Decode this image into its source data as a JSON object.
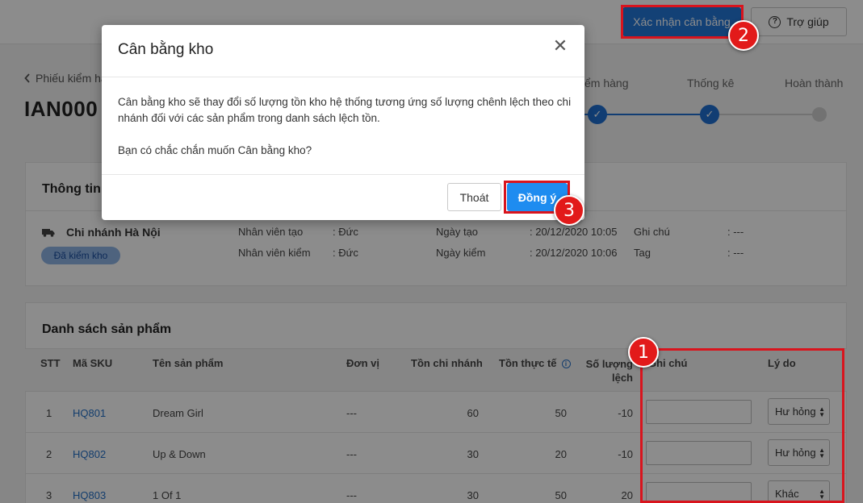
{
  "header": {
    "confirm_label": "Xác nhận cân bằng",
    "help_label": "Trợ giúp",
    "help_icon": "question-circle-icon"
  },
  "breadcrumb": {
    "label": "Phiếu kiểm hàng"
  },
  "page_title": "IAN000",
  "steps": [
    {
      "label": "Kiểm hàng",
      "visible_label": "ểm hàng",
      "state": "done"
    },
    {
      "label": "Thống kê",
      "state": "done"
    },
    {
      "label": "Hoàn thành",
      "state": "pending"
    }
  ],
  "info_card": {
    "title": "Thông tin",
    "branch": "Chi nhánh Hà Nội",
    "status_badge": "Đã kiểm kho",
    "fields": {
      "creator_label": "Nhân viên tạo",
      "creator_value": ": Đức",
      "checker_label": "Nhân viên kiểm",
      "checker_value": ": Đức",
      "created_label": "Ngày tạo",
      "created_value": ": 20/12/2020 10:05",
      "checked_label": "Ngày kiểm",
      "checked_value": ": 20/12/2020 10:06",
      "note_label": "Ghi chú",
      "note_value": ": ---",
      "tag_label": "Tag",
      "tag_value": ": ---"
    }
  },
  "product_card": {
    "title": "Danh sách sản phẩm",
    "columns": {
      "stt": "STT",
      "sku": "Mã SKU",
      "name": "Tên sản phẩm",
      "unit": "Đơn vị",
      "branch_stock": "Tồn chi nhánh",
      "actual_stock": "Tồn thực tế",
      "diff_line1": "Số lượng",
      "diff_line2": "lệch",
      "note": "Ghi chú",
      "reason": "Lý do"
    },
    "rows": [
      {
        "stt": "1",
        "sku": "HQ801",
        "name": "Dream Girl",
        "unit": "---",
        "branch_stock": "60",
        "actual_stock": "50",
        "diff": "-10",
        "reason": "Hư hỏng"
      },
      {
        "stt": "2",
        "sku": "HQ802",
        "name": "Up & Down",
        "unit": "---",
        "branch_stock": "30",
        "actual_stock": "20",
        "diff": "-10",
        "reason": "Hư hỏng"
      },
      {
        "stt": "3",
        "sku": "HQ803",
        "name": "1 Of 1",
        "unit": "---",
        "branch_stock": "30",
        "actual_stock": "50",
        "diff": "20",
        "reason": "Khác"
      }
    ]
  },
  "modal": {
    "title": "Cân bằng kho",
    "body_line1": "Cân bằng kho sẽ thay đổi số lượng tồn kho hệ thống tương ứng số lượng chênh lệch theo chi nhánh đối với các sản phẩm trong danh sách lệch tồn.",
    "body_line2": "Bạn có chắc chắn muốn Cân bằng kho?",
    "cancel_label": "Thoát",
    "ok_label": "Đồng ý"
  },
  "markers": [
    "1",
    "2",
    "3"
  ],
  "colors": {
    "primary": "#2477d8",
    "ok_button": "#1e8cf0",
    "highlight": "#d9141d",
    "link": "#2470c7"
  }
}
